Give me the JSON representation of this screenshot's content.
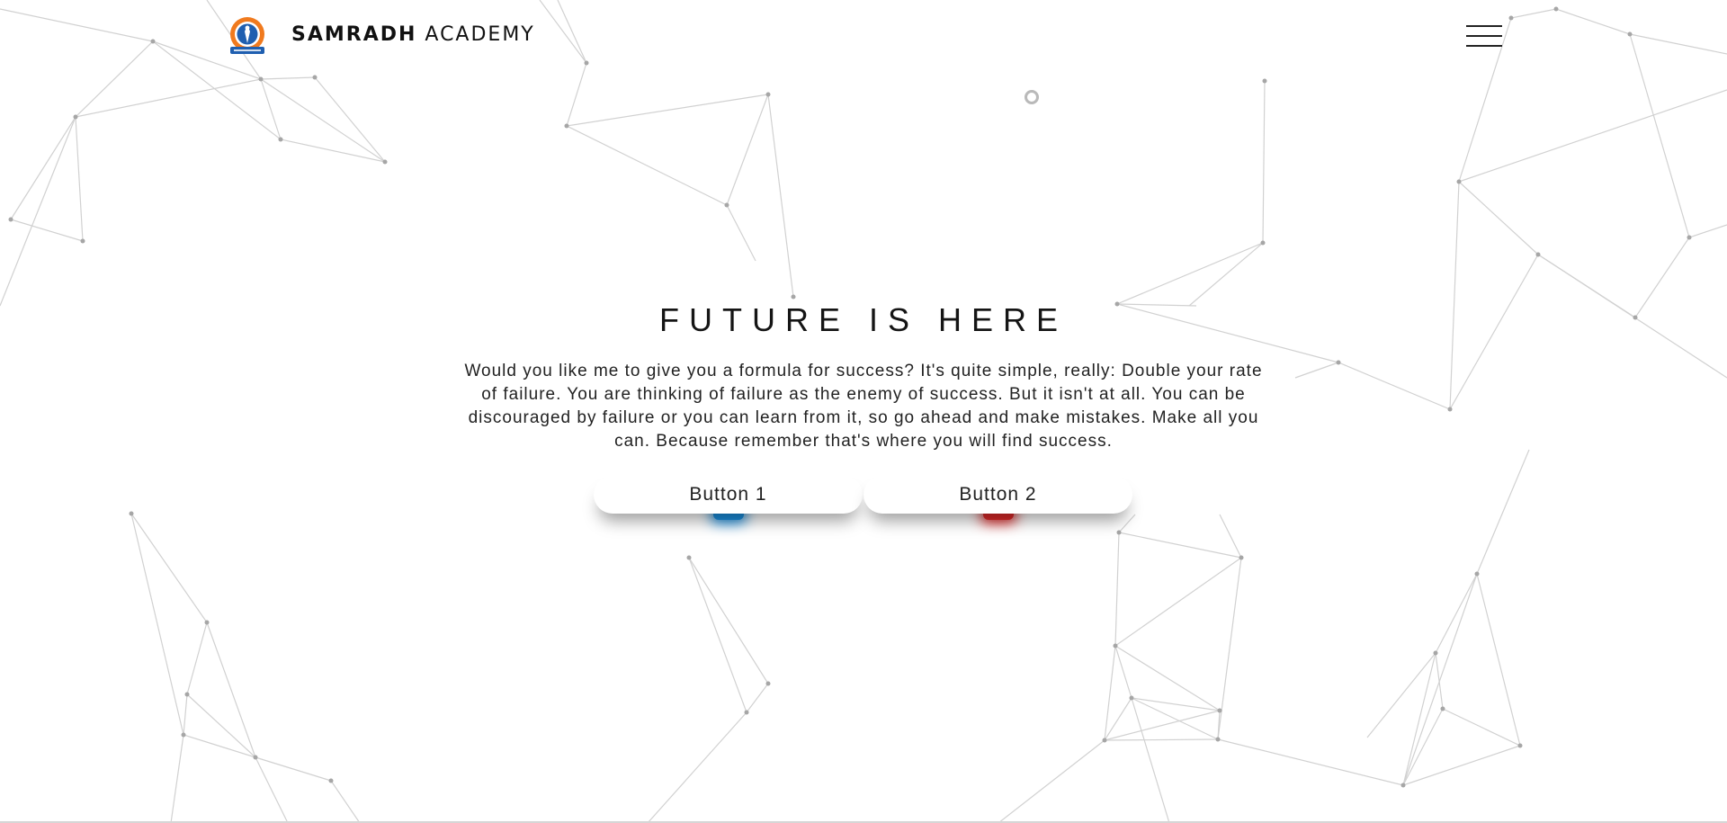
{
  "header": {
    "brand_bold": "SAMRADH",
    "brand_light": "ACADEMY",
    "logo_icon": "academy-crest-logo",
    "menu_icon": "hamburger-menu-icon"
  },
  "hero": {
    "title": "FUTURE IS HERE",
    "text": "Would you like me to give you a formula for success? It's quite simple, really: Double your rate of failure. You are thinking of failure as the enemy of success. But it isn't at all. You can be discouraged by failure or you can learn from it, so go ahead and make mistakes. Make all you can. Because remember that's where you will find success."
  },
  "buttons": [
    {
      "label": "Button 1",
      "glow_color": "#1a8fe0"
    },
    {
      "label": "Button 2",
      "glow_color": "#e02a2a"
    }
  ],
  "colors": {
    "background": "#ffffff",
    "network_line": "#c8c8c8",
    "network_node": "#a8a8a8",
    "logo_orange": "#f07a1e",
    "logo_blue": "#1f5fb0"
  }
}
